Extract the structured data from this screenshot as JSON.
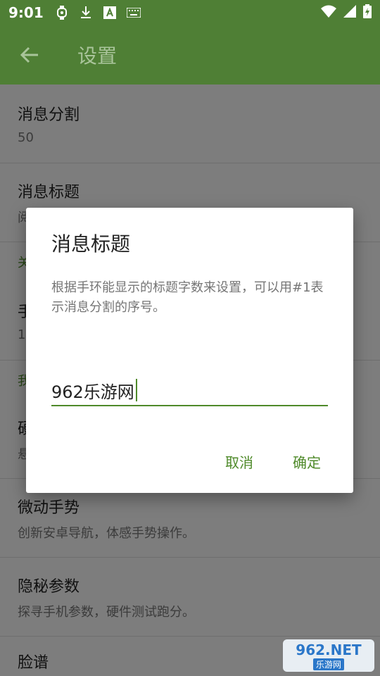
{
  "status_bar": {
    "time": "9:01",
    "icons": [
      "watch-icon",
      "download-icon",
      "font-icon",
      "keyboard-icon"
    ],
    "right_icons": [
      "wifi-icon",
      "signal-icon",
      "battery-icon"
    ]
  },
  "app_bar": {
    "title": "设置",
    "back_icon": "arrow-back-icon"
  },
  "settings": {
    "items": [
      {
        "title": "消息分割",
        "subtitle": "50"
      },
      {
        "title": "消息标题",
        "subtitle": "阅"
      },
      {
        "category": "关"
      },
      {
        "title": "手",
        "subtitle": "1"
      },
      {
        "category": "我"
      },
      {
        "title": "硬",
        "subtitle": "悬"
      },
      {
        "title": "微动手势",
        "subtitle": "创新安卓导航，体感手势操作。"
      },
      {
        "title": "隐秘参数",
        "subtitle": "探寻手机参数，硬件测试跑分。"
      },
      {
        "title": "脸谱",
        "subtitle": ""
      }
    ]
  },
  "dialog": {
    "title": "消息标题",
    "message": "根据手环能显示的标题字数来设置，可以用#1表示消息分割的序号。",
    "input_value": "962乐游网",
    "cancel_label": "取消",
    "ok_label": "确定"
  },
  "watermark": {
    "brand": "962.NET",
    "sub": "乐游网"
  },
  "colors": {
    "primary": "#4f7f35",
    "accent": "#4f8a2a"
  }
}
